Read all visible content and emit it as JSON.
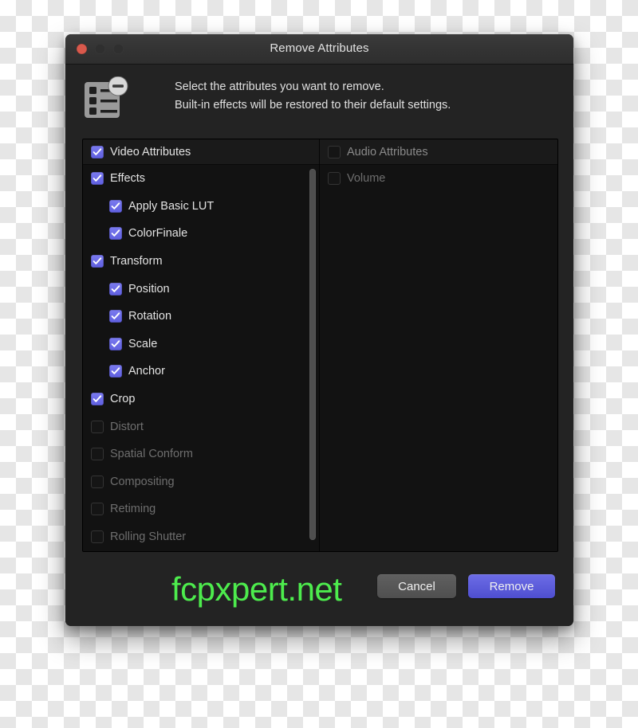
{
  "window": {
    "title": "Remove Attributes",
    "traffic_lights": {
      "close": "close-button",
      "minimize": "minimize-button",
      "zoom": "zoom-button"
    }
  },
  "header": {
    "icon": "remove-attributes-icon",
    "message_line1": "Select the attributes you want to remove.",
    "message_line2": "Built-in effects will be restored to their default settings."
  },
  "columns": {
    "video": {
      "header": {
        "label": "Video Attributes",
        "checked": true,
        "enabled": true
      },
      "items": [
        {
          "label": "Effects",
          "checked": true,
          "indent": 0,
          "enabled": true
        },
        {
          "label": "Apply Basic LUT",
          "checked": true,
          "indent": 1,
          "enabled": true
        },
        {
          "label": "ColorFinale",
          "checked": true,
          "indent": 1,
          "enabled": true
        },
        {
          "label": "Transform",
          "checked": true,
          "indent": 0,
          "enabled": true
        },
        {
          "label": "Position",
          "checked": true,
          "indent": 1,
          "enabled": true
        },
        {
          "label": "Rotation",
          "checked": true,
          "indent": 1,
          "enabled": true
        },
        {
          "label": "Scale",
          "checked": true,
          "indent": 1,
          "enabled": true
        },
        {
          "label": "Anchor",
          "checked": true,
          "indent": 1,
          "enabled": true
        },
        {
          "label": "Crop",
          "checked": true,
          "indent": 0,
          "enabled": true
        },
        {
          "label": "Distort",
          "checked": false,
          "indent": 0,
          "enabled": false
        },
        {
          "label": "Spatial Conform",
          "checked": false,
          "indent": 0,
          "enabled": false
        },
        {
          "label": "Compositing",
          "checked": false,
          "indent": 0,
          "enabled": false
        },
        {
          "label": "Retiming",
          "checked": false,
          "indent": 0,
          "enabled": false
        },
        {
          "label": "Rolling Shutter",
          "checked": false,
          "indent": 0,
          "enabled": false
        }
      ]
    },
    "audio": {
      "header": {
        "label": "Audio Attributes",
        "checked": false,
        "enabled": false
      },
      "items": [
        {
          "label": "Volume",
          "checked": false,
          "indent": 0,
          "enabled": false
        }
      ]
    }
  },
  "footer": {
    "watermark": "fcpxpert.net",
    "cancel_label": "Cancel",
    "remove_label": "Remove"
  },
  "colors": {
    "accent": "#5f5fe0",
    "watermark": "#4dec4d",
    "close_button": "#d9594c",
    "window_background": "#232323",
    "list_background": "#121212"
  }
}
